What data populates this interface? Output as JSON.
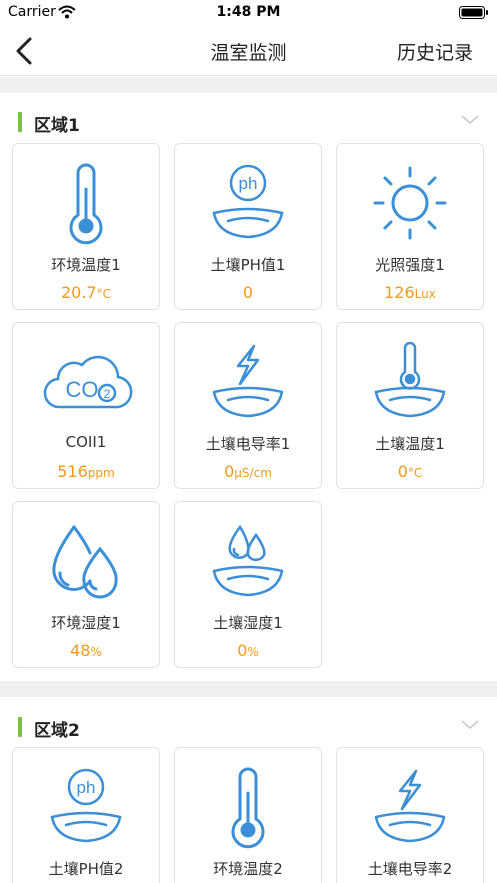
{
  "status": {
    "carrier": "Carrier",
    "time": "1:48 PM"
  },
  "nav": {
    "title": "温室监测",
    "history_label": "历史记录"
  },
  "sections": [
    {
      "title": "区域1",
      "cards": [
        {
          "label": "环境温度1",
          "value": "20.7",
          "unit": "°C",
          "icon": "thermometer-icon"
        },
        {
          "label": "土壤PH值1",
          "value": "0",
          "unit": "",
          "icon": "soil-ph-icon"
        },
        {
          "label": "光照强度1",
          "value": "126",
          "unit": "Lux",
          "icon": "sun-icon"
        },
        {
          "label": "COII1",
          "value": "516",
          "unit": "ppm",
          "icon": "co2-cloud-icon"
        },
        {
          "label": "土壤电导率1",
          "value": "0",
          "unit": "μS/cm",
          "icon": "soil-conductivity-icon"
        },
        {
          "label": "土壤温度1",
          "value": "0",
          "unit": "°C",
          "icon": "soil-temperature-icon"
        },
        {
          "label": "环境湿度1",
          "value": "48",
          "unit": "%",
          "icon": "humidity-drops-icon"
        },
        {
          "label": "土壤湿度1",
          "value": "0",
          "unit": "%",
          "icon": "soil-humidity-icon"
        }
      ]
    },
    {
      "title": "区域2",
      "cards": [
        {
          "label": "土壤PH值2",
          "icon": "soil-ph-icon"
        },
        {
          "label": "环境温度2",
          "icon": "thermometer-icon"
        },
        {
          "label": "土壤电导率2",
          "icon": "soil-conductivity-icon"
        }
      ]
    }
  ],
  "colors": {
    "accent_bar": "#7bc043",
    "icon_blue": "#3a8fd6",
    "value_orange": "#f39a1d"
  }
}
